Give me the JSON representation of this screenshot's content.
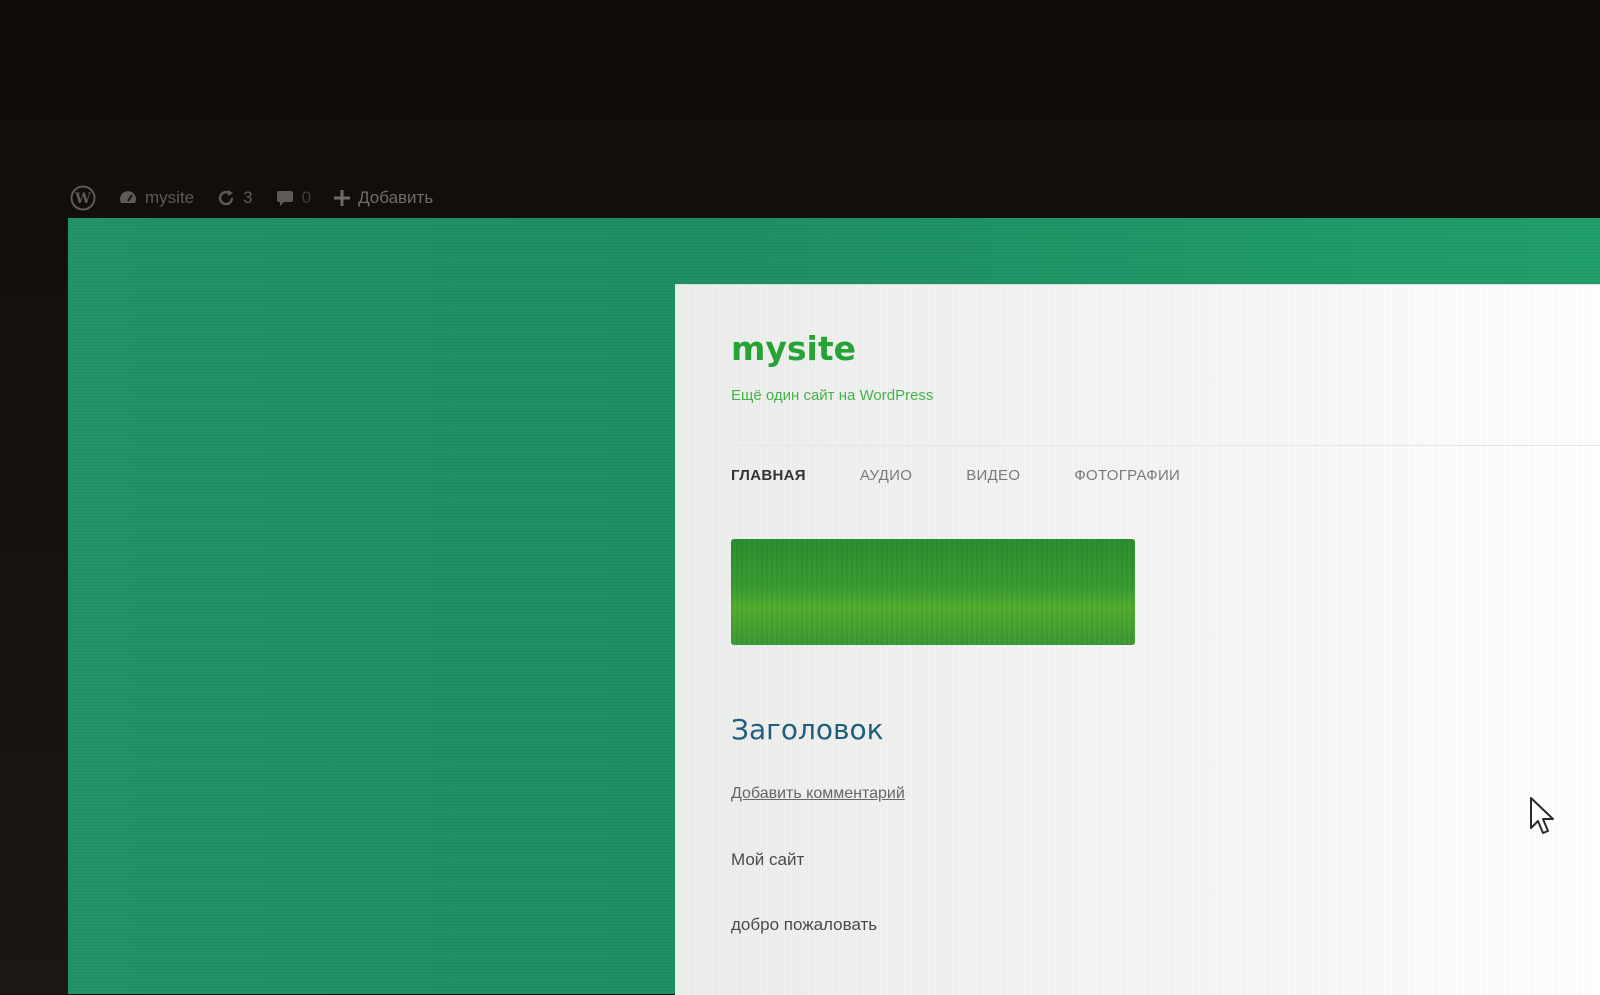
{
  "admin_bar": {
    "wp_logo_icon": "wordpress-logo-icon",
    "site_icon": "dashboard-icon",
    "site_name": "mysite",
    "updates_icon": "refresh-icon",
    "updates_count": "3",
    "comments_icon": "comment-bubble-icon",
    "comments_count": "0",
    "add_icon": "plus-icon",
    "add_label": "Добавить"
  },
  "site": {
    "title": "mysite",
    "tagline": "Ещё один сайт на WordPress",
    "background_color": "#219767",
    "title_color": "#27a234"
  },
  "nav": {
    "items": [
      {
        "label": "ГЛАВНАЯ",
        "active": true
      },
      {
        "label": "АУДИО",
        "active": false
      },
      {
        "label": "ВИДЕО",
        "active": false
      },
      {
        "label": "ФОТОГРАФИИ",
        "active": false
      }
    ]
  },
  "post": {
    "title": "Заголовок",
    "comment_link": "Добавить комментарий",
    "lines": [
      "Мой сайт",
      "добро пожаловать"
    ]
  },
  "pointer_icon": "mouse-cursor-icon"
}
